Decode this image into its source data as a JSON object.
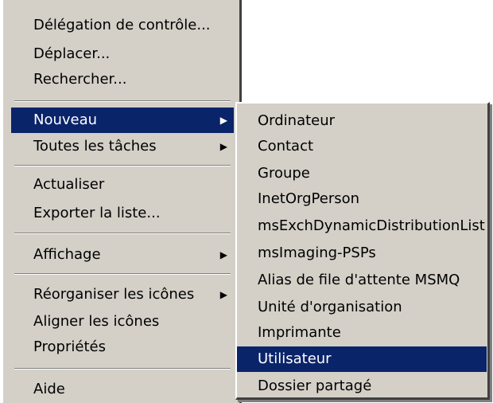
{
  "main_menu": {
    "items": [
      {
        "label": "Délégation de contrôle..."
      },
      {
        "label": "Déplacer..."
      },
      {
        "label": "Rechercher..."
      },
      {
        "label": "Nouveau",
        "arrow": "▶"
      },
      {
        "label": "Toutes les tâches",
        "arrow": "▶"
      },
      {
        "label": "Actualiser"
      },
      {
        "label": "Exporter la liste..."
      },
      {
        "label": "Affichage",
        "arrow": "▶"
      },
      {
        "label": "Réorganiser les icônes",
        "arrow": "▶"
      },
      {
        "label": "Aligner les icônes"
      },
      {
        "label": "Propriétés"
      },
      {
        "label": "Aide"
      }
    ],
    "highlighted": "Nouveau"
  },
  "sub_menu": {
    "items": [
      {
        "label": "Ordinateur"
      },
      {
        "label": "Contact"
      },
      {
        "label": "Groupe"
      },
      {
        "label": "InetOrgPerson"
      },
      {
        "label": "msExchDynamicDistributionList"
      },
      {
        "label": "msImaging-PSPs"
      },
      {
        "label": "Alias de file d'attente MSMQ"
      },
      {
        "label": "Unité d'organisation"
      },
      {
        "label": "Imprimante"
      },
      {
        "label": "Utilisateur"
      },
      {
        "label": "Dossier partagé"
      }
    ],
    "highlighted": "Utilisateur"
  },
  "colors": {
    "menu_background": "#d4d0c8",
    "highlight_background": "#0a246a",
    "highlight_text": "#ffffff",
    "text": "#000000"
  }
}
